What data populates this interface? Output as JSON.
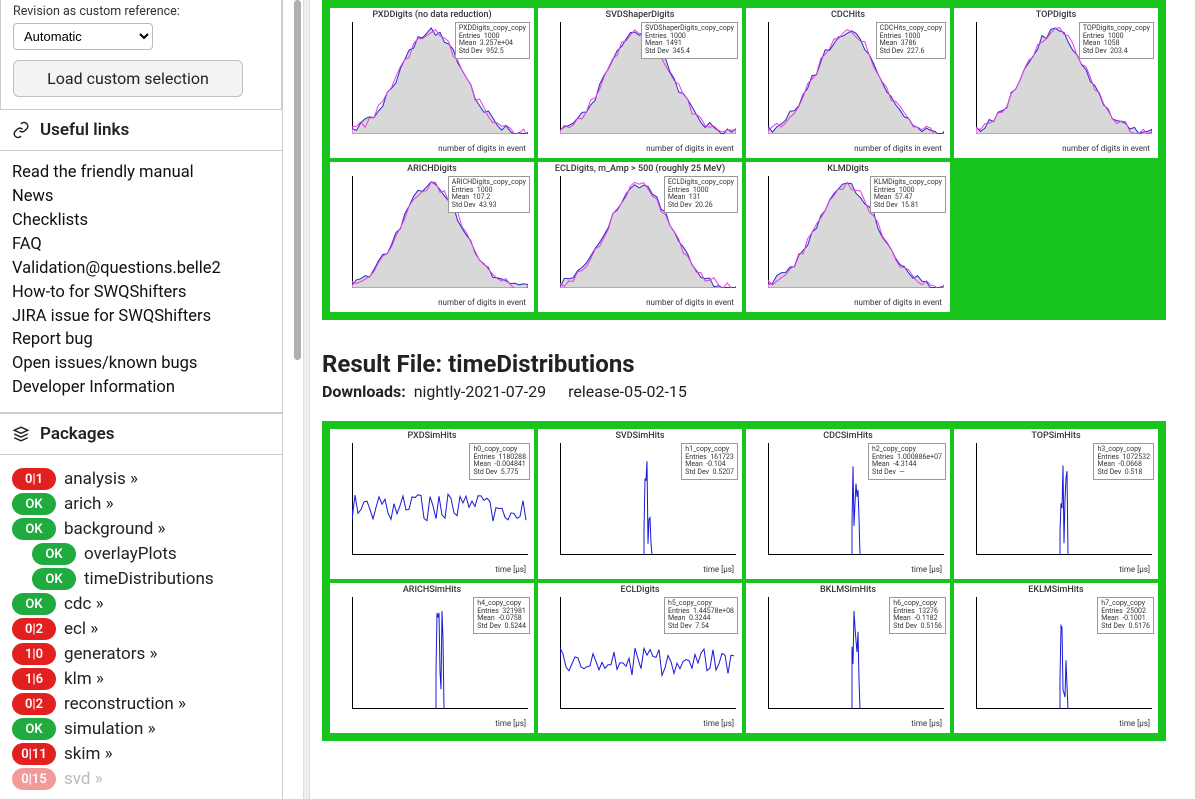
{
  "sidebar": {
    "revision_label": "Revision as custom reference:",
    "revision_select": "Automatic",
    "load_btn": "Load custom selection",
    "useful_links_title": "Useful links",
    "links": [
      "Read the friendly manual",
      "News",
      "Checklists",
      "FAQ",
      "Validation@questions.belle2",
      "How-to for SWQShifters",
      "JIRA issue for SWQShifters",
      "Report bug",
      "Open issues/known bugs",
      "Developer Information"
    ],
    "packages_title": "Packages",
    "packages": [
      {
        "badge": "0|1",
        "cls": "red",
        "name": "analysis »"
      },
      {
        "badge": "OK",
        "cls": "green",
        "name": "arich »"
      },
      {
        "badge": "OK",
        "cls": "green",
        "name": "background »"
      },
      {
        "badge": "OK",
        "cls": "green",
        "name": "overlayPlots",
        "sub": true
      },
      {
        "badge": "OK",
        "cls": "green",
        "name": "timeDistributions",
        "sub": true
      },
      {
        "badge": "OK",
        "cls": "green",
        "name": "cdc »"
      },
      {
        "badge": "0|2",
        "cls": "red",
        "name": "ecl »"
      },
      {
        "badge": "1|0",
        "cls": "red",
        "name": "generators »"
      },
      {
        "badge": "1|6",
        "cls": "red",
        "name": "klm »"
      },
      {
        "badge": "0|2",
        "cls": "red",
        "name": "reconstruction »"
      },
      {
        "badge": "OK",
        "cls": "green",
        "name": "simulation »"
      },
      {
        "badge": "0|11",
        "cls": "red",
        "name": "skim »"
      },
      {
        "badge": "0|15",
        "cls": "faded",
        "name": "svd »",
        "faded": true
      }
    ]
  },
  "top_plots": {
    "items": [
      {
        "title": "PXDDigits (no data reduction)",
        "stat_name": "PXDDigits_copy_copy",
        "entries": "1000",
        "mean": "3.257e+04",
        "std": "952.5"
      },
      {
        "title": "SVDShaperDigits",
        "stat_name": "SVDShaperDigits_copy_copy",
        "entries": "1000",
        "mean": "1491",
        "std": "345.4"
      },
      {
        "title": "CDCHits",
        "stat_name": "CDCHits_copy_copy",
        "entries": "1000",
        "mean": "3786",
        "std": "227.6"
      },
      {
        "title": "TOPDigits",
        "stat_name": "TOPDigits_copy_copy",
        "entries": "1000",
        "mean": "1058",
        "std": "203.4"
      },
      {
        "title": "ARICHDigits",
        "stat_name": "ARICHDigits_copy_copy",
        "entries": "1000",
        "mean": "107.2",
        "std": "43.93"
      },
      {
        "title": "ECLDigits, m_Amp > 500 (roughly 25 MeV)",
        "stat_name": "ECLDigits_copy_copy",
        "entries": "1000",
        "mean": "131",
        "std": "20.26"
      },
      {
        "title": "KLMDigits",
        "stat_name": "KLMDigits_copy_copy",
        "entries": "1000",
        "mean": "57.47",
        "std": "15.81"
      }
    ],
    "xlabel": "number of digits in event"
  },
  "result": {
    "title_prefix": "Result File: ",
    "title_name": "timeDistributions",
    "downloads_label": "Downloads:",
    "downloads": [
      "nightly-2021-07-29",
      "release-05-02-15"
    ]
  },
  "bottom_plots": {
    "items": [
      {
        "title": "PXDSimHits",
        "stat_name": "h0_copy_copy",
        "entries": "1180288",
        "mean": "-0.004841",
        "std": "5.775"
      },
      {
        "title": "SVDSimHits",
        "stat_name": "h1_copy_copy",
        "entries": "161723",
        "mean": "-0.104",
        "std": "0.5207"
      },
      {
        "title": "CDCSimHits",
        "stat_name": "h2_copy_copy",
        "entries": "1.000886e+07",
        "mean": "-4.3144",
        "std": "—"
      },
      {
        "title": "TOPSimHits",
        "stat_name": "h3_copy_copy",
        "entries": "1072532",
        "mean": "-0.0668",
        "std": "0.518"
      },
      {
        "title": "ARICHSimHits",
        "stat_name": "h4_copy_copy",
        "entries": "321981",
        "mean": "-0.0758",
        "std": "0.5244"
      },
      {
        "title": "ECLDigits",
        "stat_name": "h5_copy_copy",
        "entries": "1.44578e+08",
        "mean": "0.3244",
        "std": "7.54"
      },
      {
        "title": "BKLMSimHits",
        "stat_name": "h6_copy_copy",
        "entries": "13276",
        "mean": "-0.1182",
        "std": "0.5156"
      },
      {
        "title": "EKLMSimHits",
        "stat_name": "h7_copy_copy",
        "entries": "25002",
        "mean": "-0.1001",
        "std": "0.5176"
      }
    ],
    "xlabel": "time [μs]"
  },
  "stat_labels": {
    "entries": "Entries",
    "mean": "Mean",
    "std": "Std Dev"
  }
}
